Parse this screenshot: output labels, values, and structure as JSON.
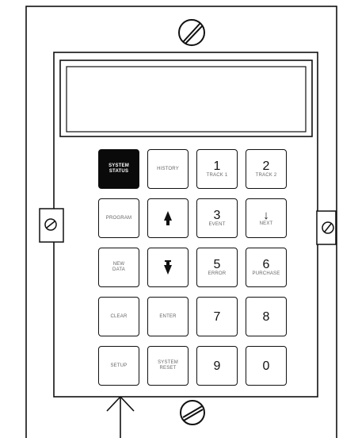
{
  "keys": {
    "system_status": "SYSTEM STATUS",
    "history": "HISTORY",
    "k1": "1",
    "k1_sub": "TRACK 1",
    "k2": "2",
    "k2_sub": "TRACK 2",
    "program": "PROGRAM",
    "up_icon": "up-arrow-icon",
    "k3": "3",
    "k3_sub": "EVENT",
    "down_arrow": "↓",
    "down_sub": "NEXT",
    "new_data": "NEW DATA",
    "down_icon": "down-arrow-icon",
    "k5": "5",
    "k5_sub": "ERROR",
    "k6": "6",
    "k6_sub": "PURCHASE",
    "clear": "CLEAR",
    "enter": "ENTER",
    "k7": "7",
    "k8": "8",
    "setup": "SETUP",
    "system_reset": "SYSTEM RESET",
    "k9": "9",
    "k0": "0"
  }
}
